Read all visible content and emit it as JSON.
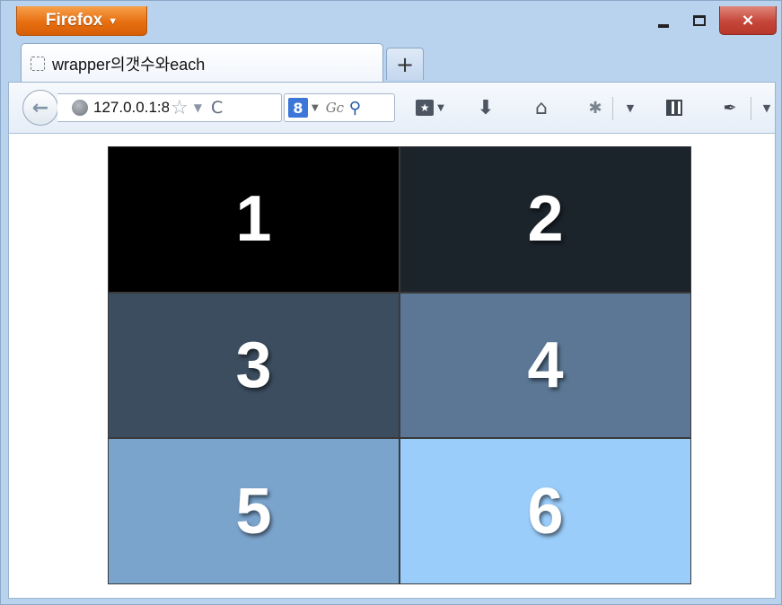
{
  "browser": {
    "app_button_label": "Firefox",
    "close_label": "×",
    "new_tab_label": "+"
  },
  "tab": {
    "title": "wrapper의갯수와each"
  },
  "navbar": {
    "back_glyph": "←",
    "url": "127.0.0.1:8",
    "star_glyph": "☆",
    "dropmarker_glyph": "▼",
    "reload_glyph": "C",
    "search_engine_label": "8",
    "search_placeholder": "Gc",
    "search_glyph": "⚲"
  },
  "boxes": [
    {
      "label": "1",
      "color": "#000000"
    },
    {
      "label": "2",
      "color": "#1b232b"
    },
    {
      "label": "3",
      "color": "#3b4d5f"
    },
    {
      "label": "4",
      "color": "#5b7795"
    },
    {
      "label": "5",
      "color": "#7ba4cd"
    },
    {
      "label": "6",
      "color": "#9bcdfa"
    }
  ]
}
